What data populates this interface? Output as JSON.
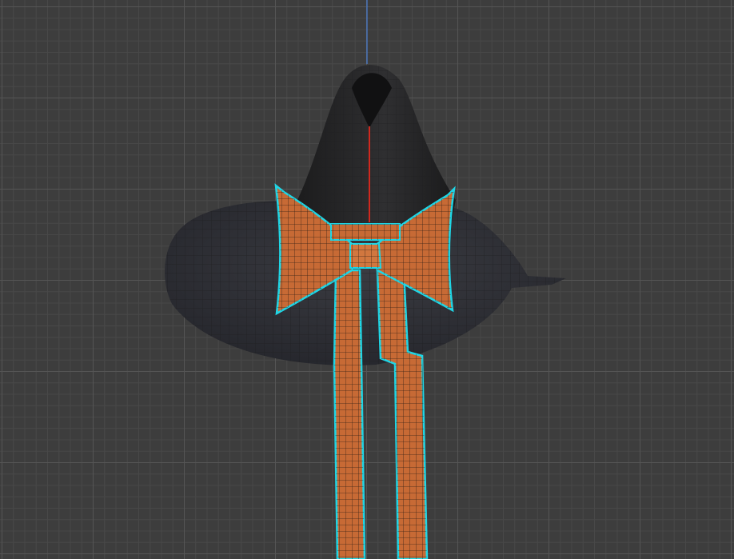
{
  "viewport": {
    "name": "3D Viewport",
    "background_color": "#3d3d3d",
    "grid_major_color": "#555555",
    "grid_minor_color": "#484848"
  },
  "axes": {
    "vertical_axis_color": "#4a7fd6",
    "cursor_axis_color": "#d0281e"
  },
  "objects": [
    {
      "name": "witch-hat",
      "color": "#2b2b2e",
      "wire_color": "#1e1e20",
      "selected": false
    },
    {
      "name": "bow",
      "color": "#c76a35",
      "wire_color": "#3a2416",
      "selected": true,
      "outline_color": "#1fd6e6"
    },
    {
      "name": "ribbon-left",
      "color": "#c76a35",
      "selected": true
    },
    {
      "name": "ribbon-right",
      "color": "#c76a35",
      "selected": true
    }
  ]
}
